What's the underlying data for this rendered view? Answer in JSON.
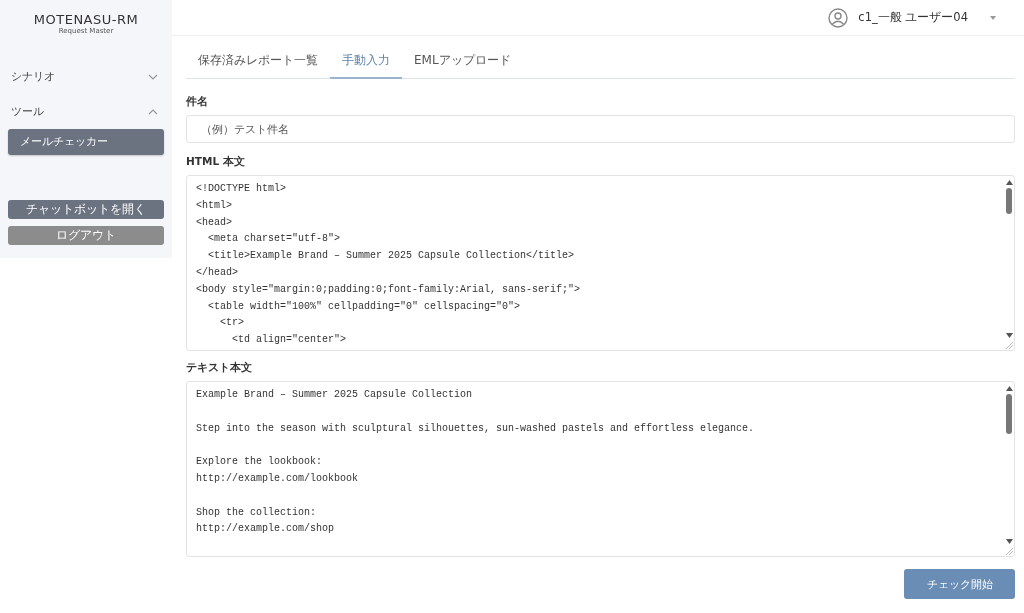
{
  "logo": {
    "name": "MOTENASU-RM",
    "tagline": "Request Master"
  },
  "sidebar": {
    "items": [
      {
        "label": "シナリオ",
        "expanded": false
      },
      {
        "label": "ツール",
        "expanded": true,
        "children": [
          {
            "label": "メールチェッカー",
            "selected": true
          }
        ]
      }
    ],
    "buttons": [
      {
        "label": "チャットボットを開く",
        "kind": "primary"
      },
      {
        "label": "ログアウト",
        "kind": "secondary"
      }
    ]
  },
  "header": {
    "user": "c1_一般 ユーザー04"
  },
  "tabs": [
    {
      "label": "保存済みレポート一覧",
      "selected": false
    },
    {
      "label": "手動入力",
      "selected": true
    },
    {
      "label": "EMLアップロード",
      "selected": false
    }
  ],
  "subject": {
    "label": "件名",
    "placeholder": "（例）テスト件名"
  },
  "html_body": {
    "label": "HTML 本文",
    "lines": [
      "<!DOCTYPE html>",
      "<html>",
      "<head>",
      "  <meta charset=\"utf-8\">",
      "  <title>Example Brand – Summer 2025 Capsule Collection</title>",
      "</head>",
      "<body style=\"margin:0;padding:0;font-family:Arial, sans-serif;\">",
      "  <table width=\"100%\" cellpadding=\"0\" cellspacing=\"0\">",
      "    <tr>",
      "      <td align=\"center\">"
    ]
  },
  "text_body": {
    "label": "テキスト本文",
    "paragraphs": [
      [
        "Example Brand – Summer 2025 Capsule Collection"
      ],
      [
        "Step into the season with sculptural silhouettes, sun-washed pastels and effortless elegance."
      ],
      [
        "Explore the lookbook:",
        "http://example.com/lookbook"
      ],
      [
        "Shop the collection:",
        "http://example.com/shop"
      ]
    ]
  },
  "submit": {
    "label": "チェック開始"
  }
}
